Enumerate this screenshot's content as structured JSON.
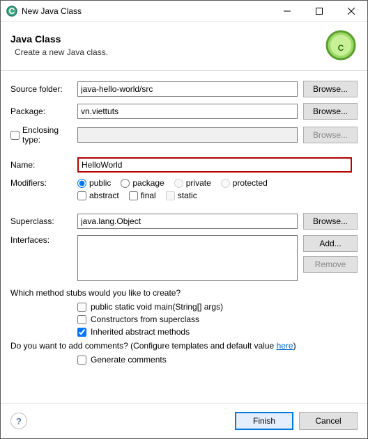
{
  "window": {
    "title": "New Java Class"
  },
  "header": {
    "title": "Java Class",
    "subtitle": "Create a new Java class."
  },
  "form": {
    "sourceFolder": {
      "label": "Source folder:",
      "value": "java-hello-world/src",
      "browse": "Browse..."
    },
    "package": {
      "label": "Package:",
      "value": "vn.viettuts",
      "browse": "Browse..."
    },
    "enclosing": {
      "label": "Enclosing type:",
      "value": "",
      "browse": "Browse..."
    },
    "name": {
      "label": "Name:",
      "value": "HelloWorld"
    },
    "modifiers": {
      "label": "Modifiers:",
      "visibility": {
        "public": "public",
        "package": "package",
        "private": "private",
        "protected": "protected"
      },
      "flags": {
        "abstract": "abstract",
        "final": "final",
        "static": "static"
      }
    },
    "superclass": {
      "label": "Superclass:",
      "value": "java.lang.Object",
      "browse": "Browse..."
    },
    "interfaces": {
      "label": "Interfaces:",
      "add": "Add...",
      "remove": "Remove"
    }
  },
  "stubs": {
    "question": "Which method stubs would you like to create?",
    "main": "public static void main(String[] args)",
    "constructors": "Constructors from superclass",
    "inherited": "Inherited abstract methods"
  },
  "comments": {
    "question1": "Do you want to add comments? (Configure templates and default value ",
    "link": "here",
    "question2": ")",
    "generate": "Generate comments"
  },
  "footer": {
    "finish": "Finish",
    "cancel": "Cancel"
  }
}
